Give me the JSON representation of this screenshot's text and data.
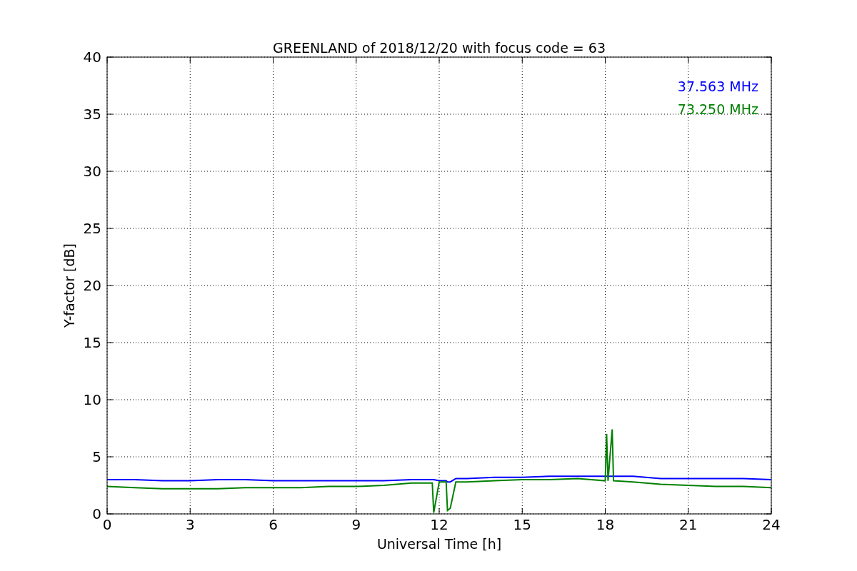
{
  "figure": {
    "chart_data": {
      "type": "line",
      "title": "GREENLAND of 2018/12/20 with focus code = 63",
      "xlabel": "Universal Time [h]",
      "ylabel": "Y-factor [dB]",
      "x": [
        0,
        1,
        2,
        3,
        4,
        5,
        6,
        7,
        8,
        9,
        10,
        11,
        11.75,
        11.8,
        12,
        12.25,
        12.3,
        12.4,
        12.6,
        13,
        14,
        15,
        16,
        17,
        18,
        18.05,
        18.1,
        18.25,
        18.3,
        19,
        20,
        21,
        22,
        23,
        24
      ],
      "series": [
        {
          "name": "37.563 MHz",
          "color": "#0000ff",
          "values": [
            3.0,
            3.0,
            2.9,
            2.9,
            3.0,
            3.0,
            2.9,
            2.9,
            2.9,
            2.9,
            2.9,
            3.0,
            3.0,
            3.0,
            2.9,
            2.9,
            2.8,
            2.8,
            3.1,
            3.1,
            3.2,
            3.2,
            3.3,
            3.3,
            3.3,
            3.3,
            3.3,
            3.3,
            3.3,
            3.3,
            3.1,
            3.1,
            3.1,
            3.1,
            3.0
          ]
        },
        {
          "name": "73.250 MHz",
          "color": "#008000",
          "values": [
            2.4,
            2.3,
            2.2,
            2.2,
            2.2,
            2.3,
            2.3,
            2.3,
            2.4,
            2.4,
            2.5,
            2.7,
            2.7,
            0.1,
            2.8,
            2.8,
            0.3,
            0.5,
            2.8,
            2.8,
            2.9,
            3.0,
            3.0,
            3.1,
            2.9,
            7.0,
            2.9,
            7.4,
            2.9,
            2.8,
            2.6,
            2.5,
            2.4,
            2.4,
            2.3
          ]
        }
      ],
      "xlim": [
        0,
        24
      ],
      "ylim": [
        0,
        40
      ],
      "xticks": [
        0,
        3,
        6,
        9,
        12,
        15,
        18,
        21,
        24
      ],
      "yticks": [
        0,
        5,
        10,
        15,
        20,
        25,
        30,
        35,
        40
      ],
      "grid": true
    }
  }
}
